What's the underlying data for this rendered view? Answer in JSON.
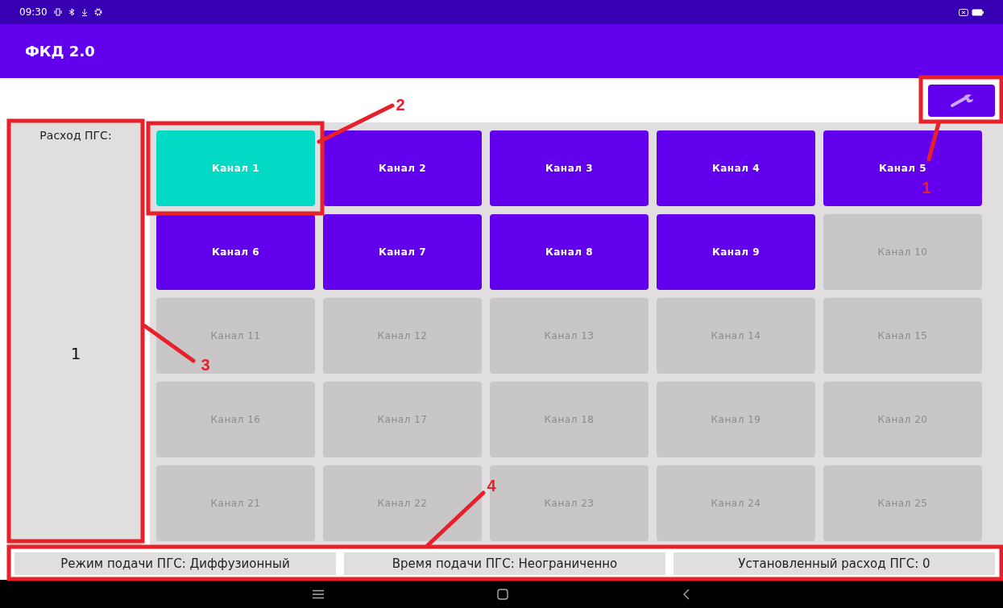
{
  "status_bar": {
    "time": "09:30"
  },
  "app_bar": {
    "title": "ФКД 2.0"
  },
  "flow_panel": {
    "label": "Расход ПГС:",
    "value": "1"
  },
  "channels": [
    {
      "label": "Канал 1",
      "selected": true,
      "disabled": false
    },
    {
      "label": "Канал 2",
      "selected": false,
      "disabled": false
    },
    {
      "label": "Канал 3",
      "selected": false,
      "disabled": false
    },
    {
      "label": "Канал 4",
      "selected": false,
      "disabled": false
    },
    {
      "label": "Канал 5",
      "selected": false,
      "disabled": false
    },
    {
      "label": "Канал 6",
      "selected": false,
      "disabled": false
    },
    {
      "label": "Канал 7",
      "selected": false,
      "disabled": false
    },
    {
      "label": "Канал 8",
      "selected": false,
      "disabled": false
    },
    {
      "label": "Канал 9",
      "selected": false,
      "disabled": false
    },
    {
      "label": "Канал 10",
      "selected": false,
      "disabled": true
    },
    {
      "label": "Канал 11",
      "selected": false,
      "disabled": true
    },
    {
      "label": "Канал 12",
      "selected": false,
      "disabled": true
    },
    {
      "label": "Канал 13",
      "selected": false,
      "disabled": true
    },
    {
      "label": "Канал 14",
      "selected": false,
      "disabled": true
    },
    {
      "label": "Канал 15",
      "selected": false,
      "disabled": true
    },
    {
      "label": "Канал 16",
      "selected": false,
      "disabled": true
    },
    {
      "label": "Канал 17",
      "selected": false,
      "disabled": true
    },
    {
      "label": "Канал 18",
      "selected": false,
      "disabled": true
    },
    {
      "label": "Канал 19",
      "selected": false,
      "disabled": true
    },
    {
      "label": "Канал 20",
      "selected": false,
      "disabled": true
    },
    {
      "label": "Канал 21",
      "selected": false,
      "disabled": true
    },
    {
      "label": "Канал 22",
      "selected": false,
      "disabled": true
    },
    {
      "label": "Канал 23",
      "selected": false,
      "disabled": true
    },
    {
      "label": "Канал 24",
      "selected": false,
      "disabled": true
    },
    {
      "label": "Канал 25",
      "selected": false,
      "disabled": true
    }
  ],
  "info_bar": [
    "Режим подачи ПГС: Диффузионный",
    "Время подачи ПГС: Неограниченно",
    "Установленный расход ПГС: 0"
  ],
  "annotations": [
    {
      "label": "1"
    },
    {
      "label": "2"
    },
    {
      "label": "3"
    },
    {
      "label": "4"
    }
  ]
}
